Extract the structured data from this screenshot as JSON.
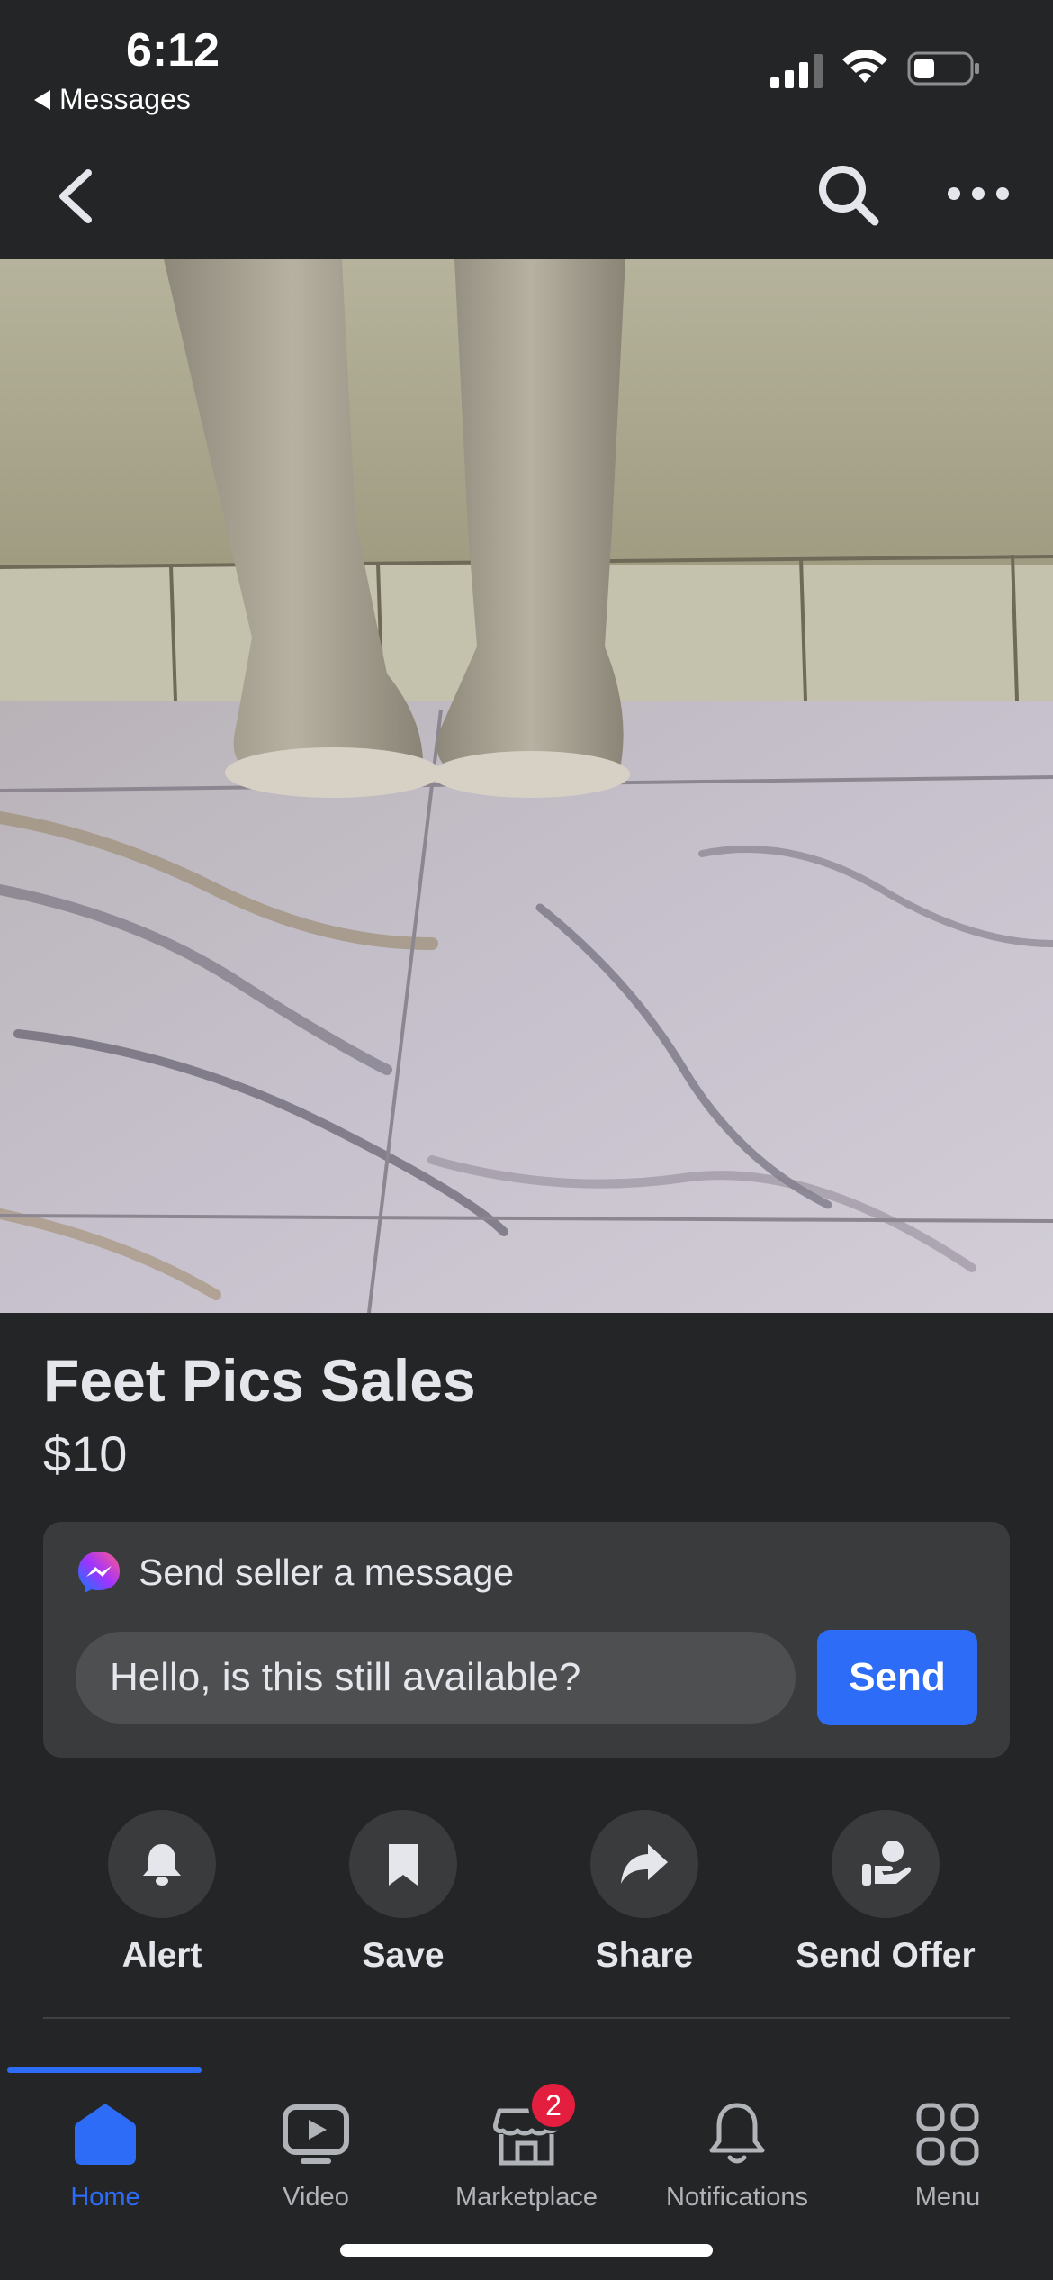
{
  "status_bar": {
    "time": "6:12",
    "back_app": "Messages",
    "icons": [
      "signal-icon",
      "wifi-icon",
      "battery-icon"
    ]
  },
  "nav": {
    "icons": [
      "back-chevron-icon",
      "search-icon",
      "more-icon"
    ]
  },
  "listing": {
    "title": "Feet Pics Sales",
    "price": "$10"
  },
  "message": {
    "header": "Send seller a message",
    "input_value": "Hello, is this still available?",
    "send_label": "Send"
  },
  "actions": [
    {
      "label": "Alert",
      "icon": "bell-icon"
    },
    {
      "label": "Save",
      "icon": "bookmark-icon"
    },
    {
      "label": "Share",
      "icon": "share-arrow-icon"
    },
    {
      "label": "Send Offer",
      "icon": "offer-hand-icon"
    }
  ],
  "tabs": [
    {
      "label": "Home",
      "icon": "home-icon",
      "active": true
    },
    {
      "label": "Video",
      "icon": "video-icon"
    },
    {
      "label": "Marketplace",
      "icon": "marketplace-icon",
      "badge": "2"
    },
    {
      "label": "Notifications",
      "icon": "bell-icon"
    },
    {
      "label": "Menu",
      "icon": "menu-grid-icon"
    }
  ],
  "colors": {
    "background": "#242526",
    "card": "#3a3b3c",
    "accent": "#2d6cf6",
    "badge": "#e41e3f",
    "text": "#e4e6eb",
    "muted": "#b0b3b8"
  }
}
